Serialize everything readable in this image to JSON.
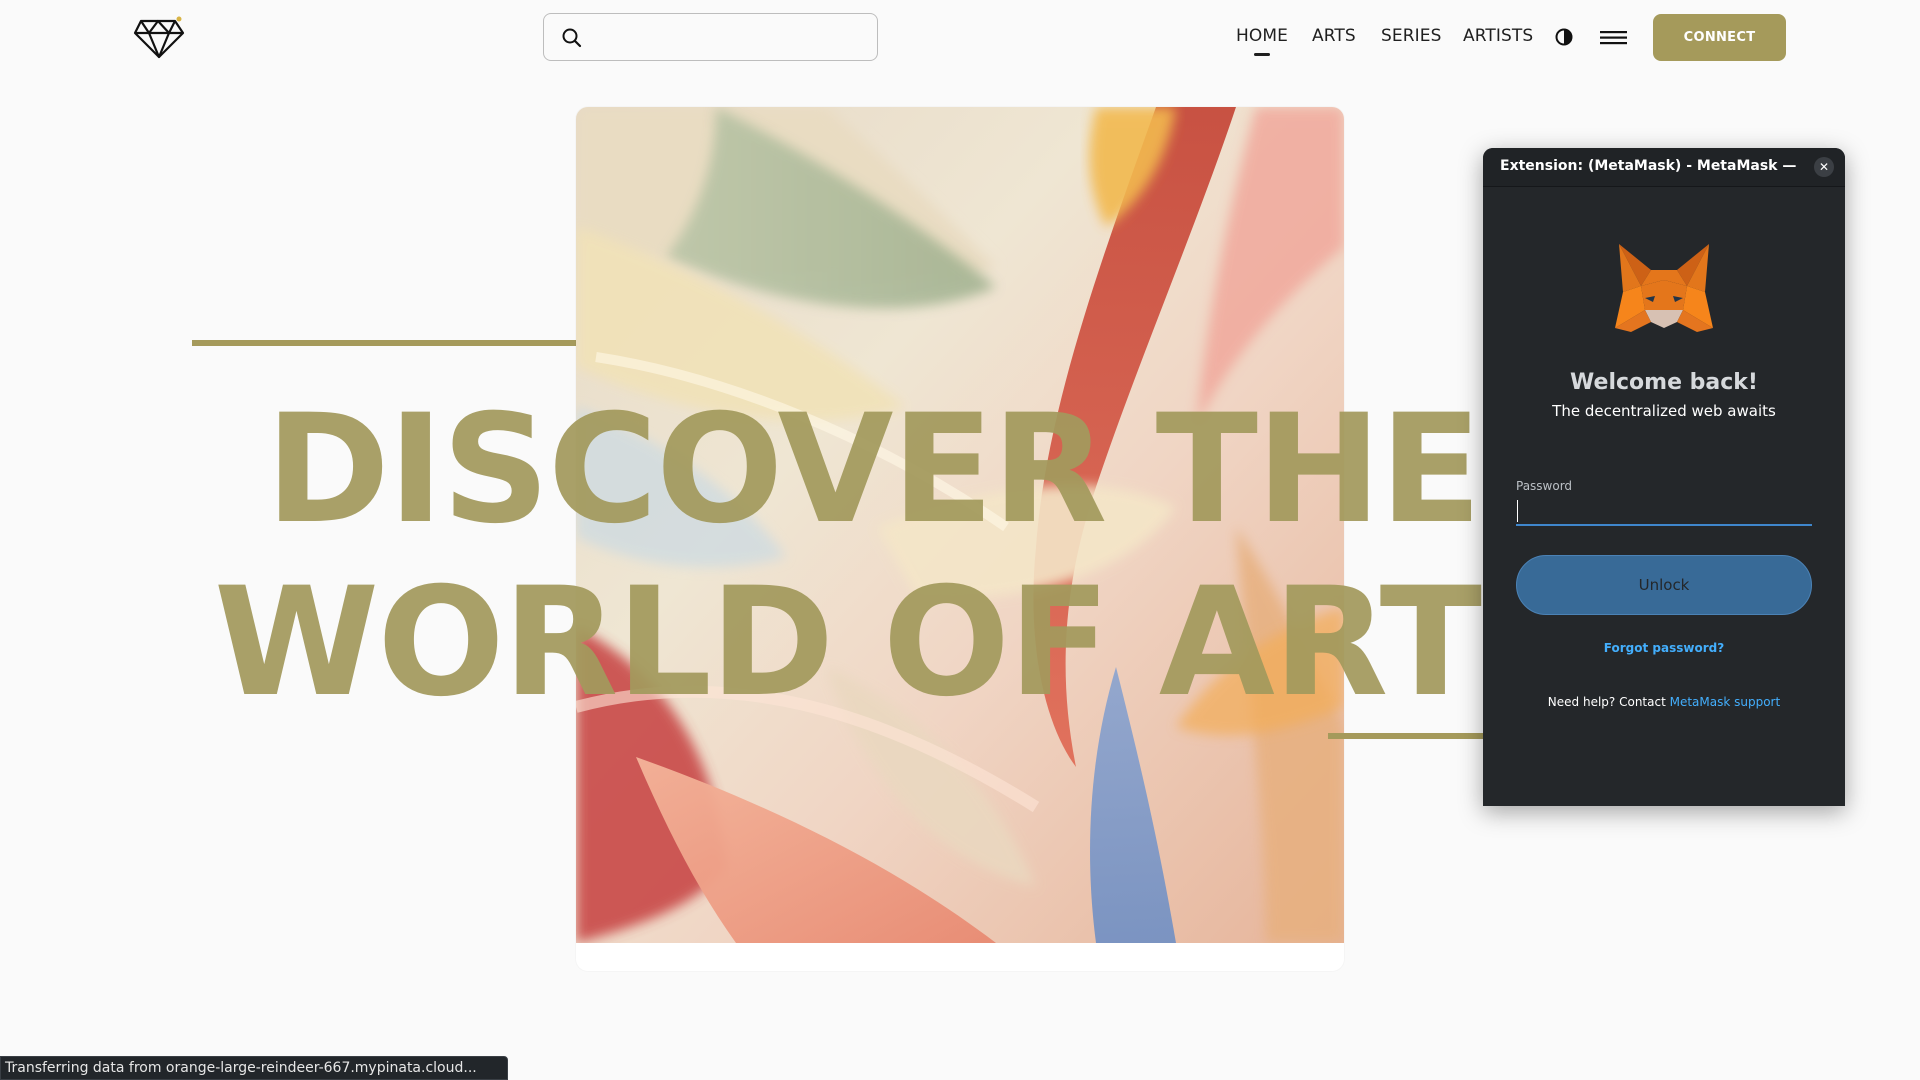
{
  "header": {
    "logo_icon": "diamond-logo-icon",
    "search": {
      "placeholder": "",
      "value": "",
      "icon": "search-icon"
    },
    "nav": [
      {
        "label": "HOME",
        "active": true
      },
      {
        "label": "ARTS",
        "active": false
      },
      {
        "label": "SERIES",
        "active": false
      },
      {
        "label": "ARTISTS",
        "active": false
      }
    ],
    "theme_toggle_icon": "half-circle-contrast-icon",
    "menu_icon": "hamburger-menu-icon",
    "connect_label": "CONNECT"
  },
  "hero": {
    "headline_line1": "DISCOVER THE",
    "headline_line2": "WORLD OF ART",
    "artwork": "abstract flowing silk fabric artwork",
    "accent_color": "#a59a5b"
  },
  "metamask": {
    "window_title": "Extension: (MetaMask) - MetaMask — M...",
    "close_icon": "close-icon",
    "fox_icon": "metamask-fox-icon",
    "welcome": "Welcome back!",
    "subtitle": "The decentralized web awaits",
    "password_label": "Password",
    "password_value": "",
    "unlock_label": "Unlock",
    "forgot_label": "Forgot password?",
    "help_prefix": "Need help? Contact ",
    "help_link": "MetaMask support"
  },
  "status_bar": {
    "text": "Transferring data from orange-large-reindeer-667.mypinata.cloud..."
  },
  "colors": {
    "brand_gold": "#a59a5b",
    "metamask_bg": "#24272a",
    "metamask_blue": "#43aefc",
    "unlock_button": "#386a97"
  }
}
